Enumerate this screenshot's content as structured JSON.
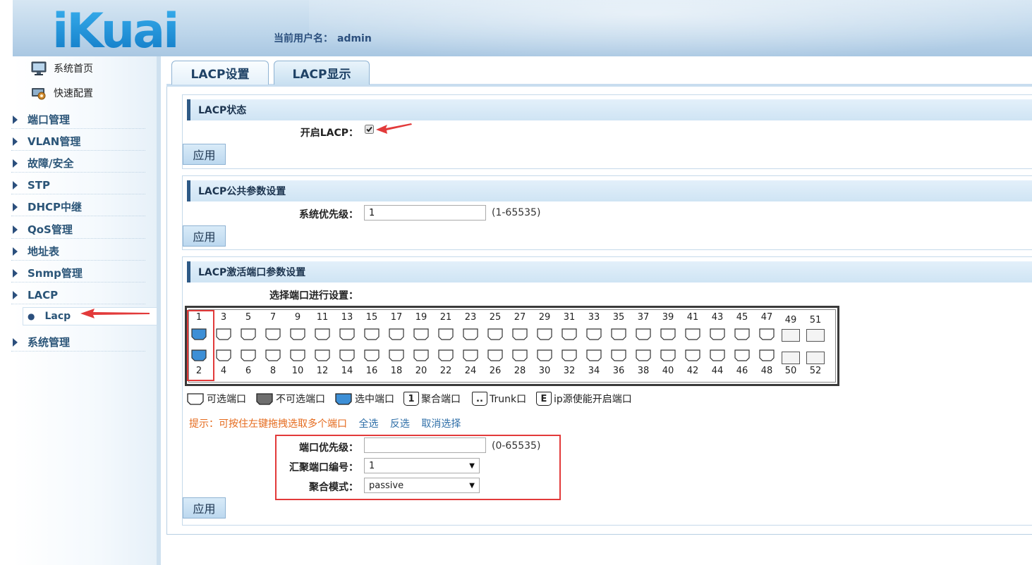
{
  "header": {
    "logo_text": "iKuai",
    "user_label": "当前用户名：",
    "username": "admin"
  },
  "sidebar": {
    "top_items": [
      {
        "label": "系统首页",
        "icon": "monitor-icon"
      },
      {
        "label": "快速配置",
        "icon": "gear-screen-icon"
      }
    ],
    "groups": [
      {
        "label": "端口管理"
      },
      {
        "label": "VLAN管理"
      },
      {
        "label": "故障/安全"
      },
      {
        "label": "STP"
      },
      {
        "label": "DHCP中继"
      },
      {
        "label": "QoS管理"
      },
      {
        "label": "地址表"
      },
      {
        "label": "Snmp管理"
      },
      {
        "label": "LACP"
      },
      {
        "label": "系统管理"
      }
    ],
    "active_sub": "Lacp"
  },
  "tabs": [
    {
      "label": "LACP设置",
      "active": true
    },
    {
      "label": "LACP显示",
      "active": false
    }
  ],
  "lacp_status": {
    "title": "LACP状态",
    "enable_label": "开启LACP：",
    "enabled": true,
    "apply_label": "应用"
  },
  "lacp_common": {
    "title": "LACP公共参数设置",
    "priority_label": "系统优先级：",
    "priority_value": "1",
    "priority_range": "(1-65535)",
    "apply_label": "应用"
  },
  "lacp_active": {
    "title": "LACP激活端口参数设置",
    "select_ports_label": "选择端口进行设置：",
    "top_ports": [
      "1",
      "3",
      "5",
      "7",
      "9",
      "11",
      "13",
      "15",
      "17",
      "19",
      "21",
      "23",
      "25",
      "27",
      "29",
      "31",
      "33",
      "35",
      "37",
      "39",
      "41",
      "43",
      "45",
      "47"
    ],
    "bottom_ports": [
      "2",
      "4",
      "6",
      "8",
      "10",
      "12",
      "14",
      "16",
      "18",
      "20",
      "22",
      "24",
      "26",
      "28",
      "30",
      "32",
      "34",
      "36",
      "38",
      "40",
      "42",
      "44",
      "46",
      "48"
    ],
    "sfp_top": [
      "49",
      "51"
    ],
    "sfp_bottom": [
      "50",
      "52"
    ],
    "selected_ports": [
      "1",
      "2"
    ],
    "legend": {
      "selectable": "可选端口",
      "unselectable": "不可选端口",
      "selected": "选中端口",
      "aggregated_mark": "1",
      "aggregated": "聚合端口",
      "trunk_mark": "..",
      "trunk": "Trunk口",
      "ipsrc_mark": "E",
      "ipsrc": "ip源使能开启端口"
    },
    "tip": "提示：可按住左键拖拽选取多个端口",
    "select_all": "全选",
    "invert": "反选",
    "cancel_select": "取消选择",
    "port_priority_label": "端口优先级：",
    "port_priority_value": "",
    "port_priority_range": "(0-65535)",
    "agg_port_label": "汇聚端口编号：",
    "agg_port_value": "1",
    "agg_mode_label": "聚合模式：",
    "agg_mode_value": "passive",
    "apply_label": "应用"
  },
  "colors": {
    "selected_port": "#3d8fd6",
    "annotation_red": "#e23a3a",
    "panel_accent": "#2e5a86",
    "tip_orange": "#e56a1c"
  }
}
